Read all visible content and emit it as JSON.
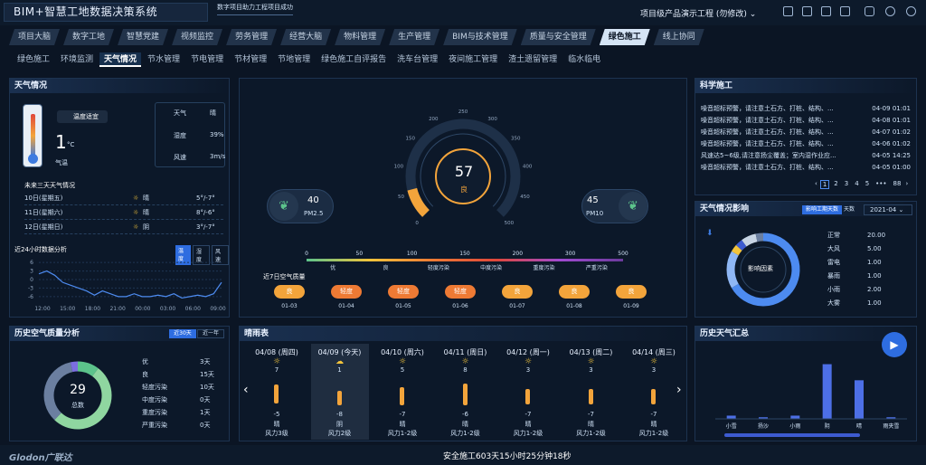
{
  "app_title": "BIM+智慧工地数据决策系统",
  "header_msg": "数字项目助力工程项目成功",
  "project": "项目级产品演示工程 (勿修改)",
  "nav_tabs": [
    "项目大脑",
    "数字工地",
    "智慧党建",
    "视频监控",
    "劳务管理",
    "经营大脑",
    "物料管理",
    "生产管理",
    "BIM与技术管理",
    "质量与安全管理",
    "绿色施工",
    "线上协同"
  ],
  "sub_tabs": [
    "绿色施工",
    "环境监测",
    "天气情况",
    "节水管理",
    "节电管理",
    "节材管理",
    "节地管理",
    "绿色施工自评报告",
    "洗车台管理",
    "夜间施工管理",
    "渣土遗留管理",
    "临水临电"
  ],
  "weather": {
    "title": "天气情况",
    "temp_label": "温度适宜",
    "temp": "1",
    "unit": "°C",
    "temp_name": "气温",
    "thermo_scale": [
      "50",
      "30",
      "10",
      "-10",
      "-30"
    ],
    "rows": [
      {
        "k": "天气",
        "v": "晴"
      },
      {
        "k": "湿度",
        "v": "39%"
      },
      {
        "k": "风速",
        "v": "3m/s"
      }
    ],
    "forecast_title": "未来三天天气情况",
    "forecast": [
      {
        "day": "10日(星期五)",
        "w": "晴",
        "t": "5°/-7°"
      },
      {
        "day": "11日(星期六)",
        "w": "晴",
        "t": "8°/-6°"
      },
      {
        "day": "12日(星期日)",
        "w": "阴",
        "t": "3°/-7°"
      }
    ],
    "chart_title": "近24小时数据分析",
    "chart_tabs": [
      "温度",
      "湿度",
      "风速"
    ]
  },
  "aqi": {
    "value": "57",
    "level": "良",
    "pm25": "40",
    "pm25_label": "PM2.5",
    "pm10": "45",
    "pm10_label": "PM10",
    "gauge_ticks": [
      "0",
      "50",
      "100",
      "150",
      "200",
      "250",
      "300",
      "350",
      "400",
      "450",
      "500"
    ],
    "scale_nums": [
      "0",
      "50",
      "100",
      "150",
      "200",
      "300",
      "500"
    ],
    "scale_levels": [
      "优",
      "良",
      "轻度污染",
      "中度污染",
      "重度污染",
      "严重污染"
    ],
    "week_title": "近7日空气质量",
    "week": [
      {
        "lv": "良",
        "d": "01-03",
        "c": "#f3a43b"
      },
      {
        "lv": "轻度",
        "d": "01-04",
        "c": "#ee7a34"
      },
      {
        "lv": "轻度",
        "d": "01-05",
        "c": "#ee7a34"
      },
      {
        "lv": "轻度",
        "d": "01-06",
        "c": "#ee7a34"
      },
      {
        "lv": "良",
        "d": "01-07",
        "c": "#f3a43b"
      },
      {
        "lv": "良",
        "d": "01-08",
        "c": "#f3a43b"
      },
      {
        "lv": "良",
        "d": "01-09",
        "c": "#f3a43b"
      }
    ]
  },
  "science": {
    "title": "科学施工",
    "items": [
      {
        "t": "噪音超标预警，请注意土石方、打桩、结构、...",
        "d": "04-09 01:01"
      },
      {
        "t": "噪音超标预警，请注意土石方、打桩、结构、...",
        "d": "04-08 01:01"
      },
      {
        "t": "噪音超标预警，请注意土石方、打桩、结构、...",
        "d": "04-07 01:02"
      },
      {
        "t": "噪音超标预警，请注意土石方、打桩、结构、...",
        "d": "04-06 01:02"
      },
      {
        "t": "风速达5~6级,请注意扬尘覆盖；室内湿作业应...",
        "d": "04-05 14:25"
      },
      {
        "t": "噪音超标预警，请注意土石方、打桩、结构、...",
        "d": "04-05 01:00"
      }
    ],
    "pages": [
      "1",
      "2",
      "3",
      "4",
      "5",
      "•••",
      "88"
    ]
  },
  "impact": {
    "title": "天气情况影响",
    "btn": "影响工期天数",
    "btn2": "天数",
    "month": "2021-04",
    "center": "影响因素",
    "items": [
      {
        "k": "正常",
        "v": "20.00"
      },
      {
        "k": "大风",
        "v": "5.00"
      },
      {
        "k": "雷电",
        "v": "1.00"
      },
      {
        "k": "暴雨",
        "v": "1.00"
      },
      {
        "k": "小雨",
        "v": "2.00"
      },
      {
        "k": "大雾",
        "v": "1.00"
      }
    ]
  },
  "history_aq": {
    "title": "历史空气质量分析",
    "tabs": [
      "近30天",
      "近一年"
    ],
    "total": "29",
    "total_label": "总数",
    "items": [
      {
        "k": "优",
        "v": "3天"
      },
      {
        "k": "良",
        "v": "15天"
      },
      {
        "k": "轻度污染",
        "v": "10天"
      },
      {
        "k": "中度污染",
        "v": "0天"
      },
      {
        "k": "重度污染",
        "v": "1天"
      },
      {
        "k": "严重污染",
        "v": "0天"
      }
    ]
  },
  "sunny": {
    "title": "晴雨表",
    "days": [
      {
        "d": "04/08 (周四)",
        "hi": "7",
        "lo": "-5",
        "w": "晴",
        "wind": "风力3级"
      },
      {
        "d": "04/09 (今天)",
        "hi": "1",
        "lo": "-8",
        "w": "阴",
        "wind": "风力2级"
      },
      {
        "d": "04/10 (周六)",
        "hi": "5",
        "lo": "-7",
        "w": "晴",
        "wind": "风力1-2级"
      },
      {
        "d": "04/11 (周日)",
        "hi": "8",
        "lo": "-6",
        "w": "晴",
        "wind": "风力1-2级"
      },
      {
        "d": "04/12 (周一)",
        "hi": "3",
        "lo": "-7",
        "w": "晴",
        "wind": "风力1-2级"
      },
      {
        "d": "04/13 (周二)",
        "hi": "3",
        "lo": "-7",
        "w": "晴",
        "wind": "风力1-2级"
      },
      {
        "d": "04/14 (周三)",
        "hi": "3",
        "lo": "-7",
        "w": "晴",
        "wind": "风力1-2级"
      }
    ]
  },
  "history_weather": {
    "title": "历史天气汇总"
  },
  "footer": {
    "logo": "Glodon广联达",
    "safe": "安全施工603天15小时25分钟18秒"
  },
  "chart_data": [
    {
      "type": "line",
      "title": "近24小时数据分析",
      "x": [
        "12:00",
        "15:00",
        "18:00",
        "21:00",
        "00:00",
        "03:00",
        "06:00",
        "09:00"
      ],
      "yticks": [
        "6",
        "3",
        "0",
        "-3",
        "-6"
      ],
      "ylim": [
        -7,
        7
      ],
      "values": [
        2,
        3,
        1.5,
        -1,
        -2,
        -3,
        -4,
        -5.5,
        -4,
        -5,
        -6,
        -6,
        -5,
        -6,
        -6,
        -5.5,
        -6,
        -5,
        -6.5,
        -6,
        -5.5,
        -6,
        -5,
        -1
      ]
    },
    {
      "type": "bar",
      "title": "历史天气汇总",
      "categories": [
        "小雪",
        "扬沙",
        "小雨",
        "阴",
        "晴",
        "雨夹雪"
      ],
      "series": [
        {
          "values": [
            2,
            1,
            2,
            34,
            24,
            1
          ]
        }
      ]
    }
  ]
}
